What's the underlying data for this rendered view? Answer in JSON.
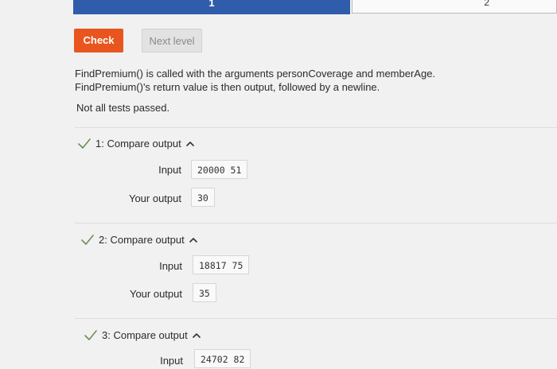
{
  "progress": {
    "active_label": "1",
    "next_label": "2"
  },
  "buttons": {
    "check_label": "Check",
    "next_label": "Next level"
  },
  "description": {
    "line1": "FindPremium() is called with the arguments personCoverage and memberAge.",
    "line2": "FindPremium()'s return value is then output, followed by a newline."
  },
  "status": "Not all tests passed.",
  "tests": [
    {
      "title": "1: Compare output",
      "input_label": "Input",
      "input_value": "20000 51",
      "output_label": "Your output",
      "output_value": "30"
    },
    {
      "title": "2: Compare output",
      "input_label": "Input",
      "input_value": "18817 75",
      "output_label": "Your output",
      "output_value": "35"
    },
    {
      "title": "3: Compare output",
      "input_label": "Input",
      "input_value": "24702 82"
    }
  ],
  "colors": {
    "accent": "#e8551f",
    "progress": "#2f5dab",
    "pass": "#6e8f5a"
  }
}
